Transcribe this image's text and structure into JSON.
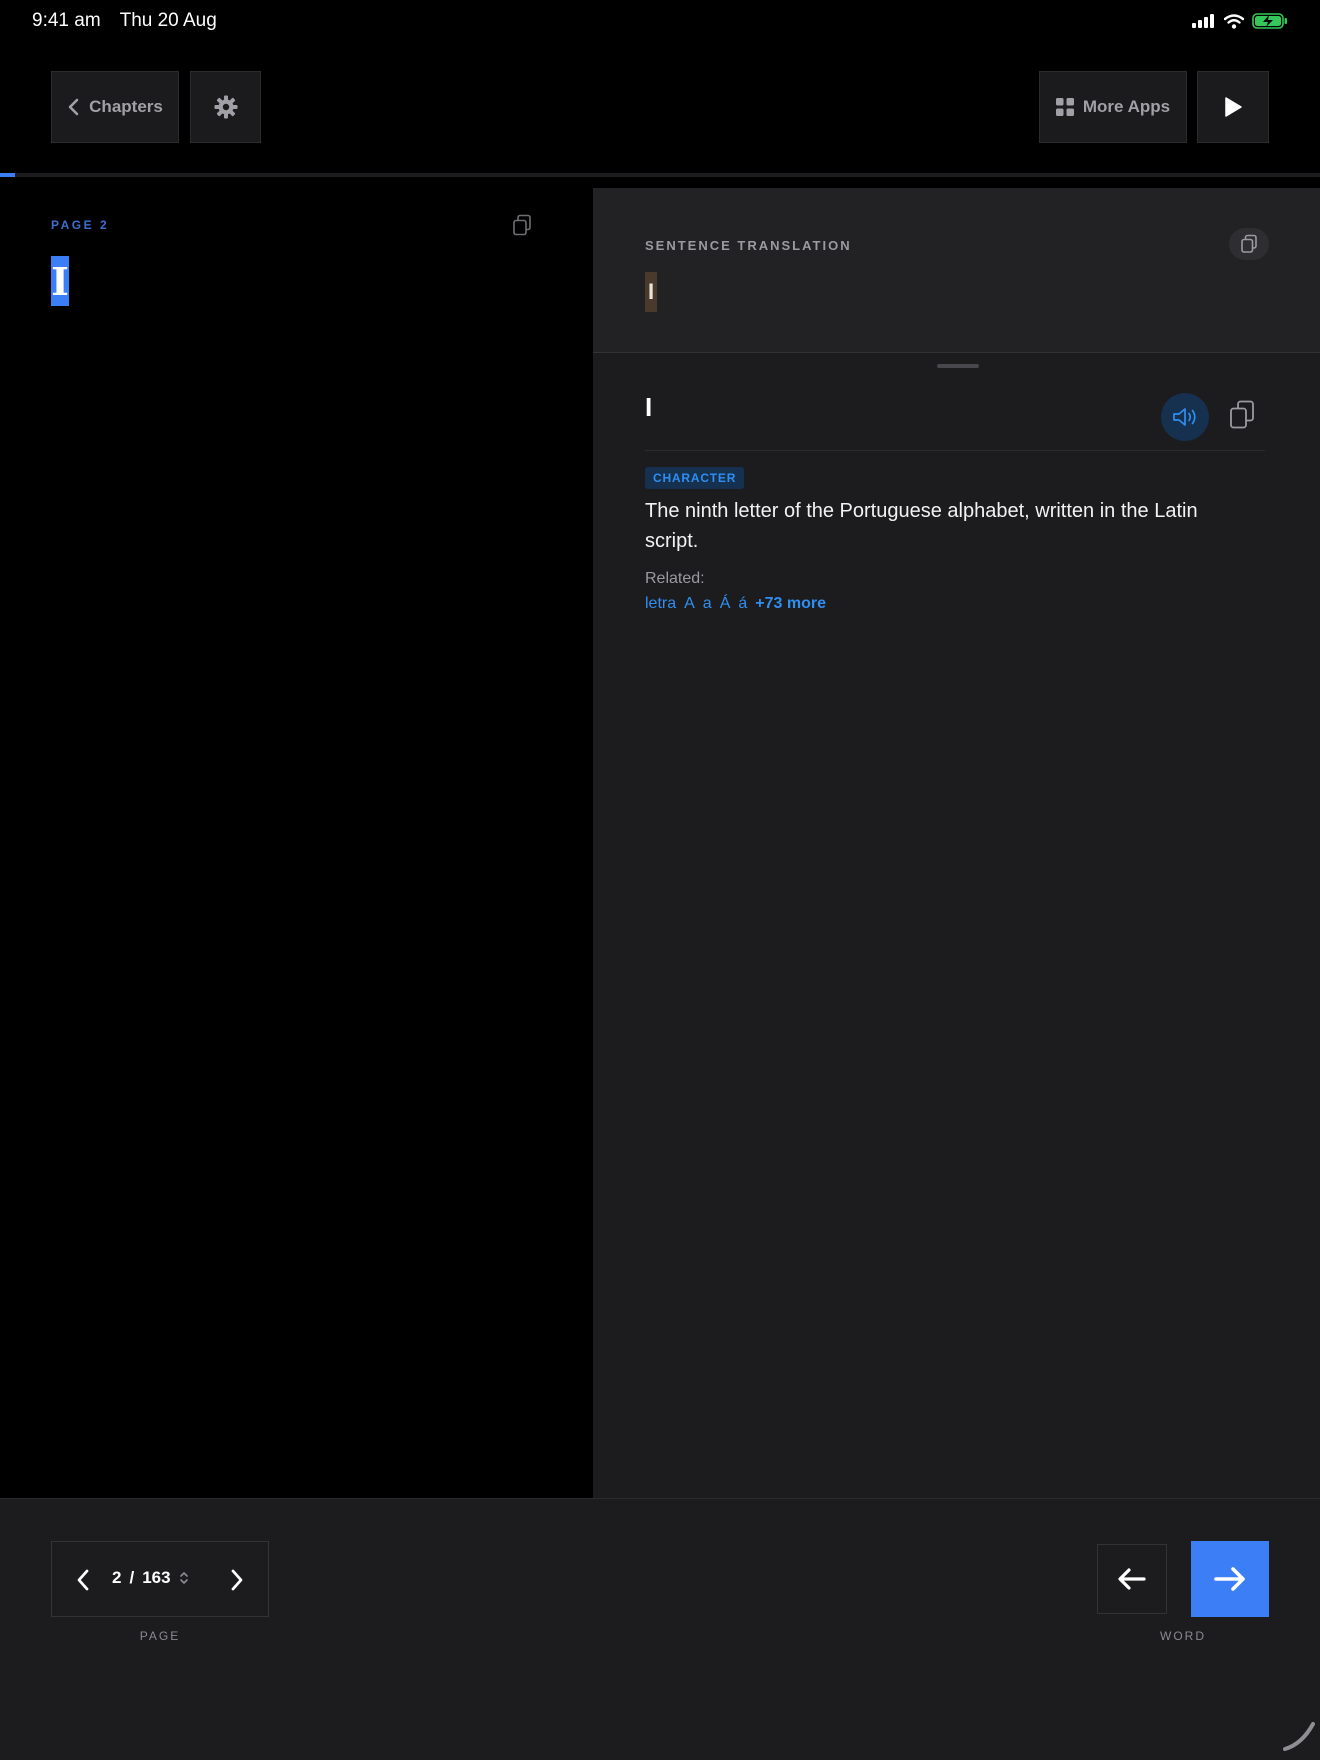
{
  "status_bar": {
    "time": "9:41 am",
    "date": "Thu 20 Aug"
  },
  "toolbar": {
    "chapters_label": "Chapters",
    "more_apps_label": "More Apps"
  },
  "reader": {
    "progress": 0.011,
    "page_label": "PAGE 2",
    "current_word": "I"
  },
  "translation": {
    "label": "SENTENCE TRANSLATION",
    "text": "I"
  },
  "dictionary": {
    "headword": "I",
    "part_of_speech": "CHARACTER",
    "definition": "The ninth letter of the Portuguese alphabet, written in the Latin script.",
    "related_label": "Related:",
    "related": [
      "letra",
      "A",
      "a",
      "Á",
      "á"
    ],
    "related_more": "+73 more"
  },
  "pager": {
    "current": "2",
    "separator": "/",
    "total": "163",
    "label": "PAGE"
  },
  "word_nav": {
    "label": "WORD"
  },
  "colors": {
    "accent": "#3b7ef6",
    "link": "#2f8ef0",
    "battery": "#34c759"
  }
}
